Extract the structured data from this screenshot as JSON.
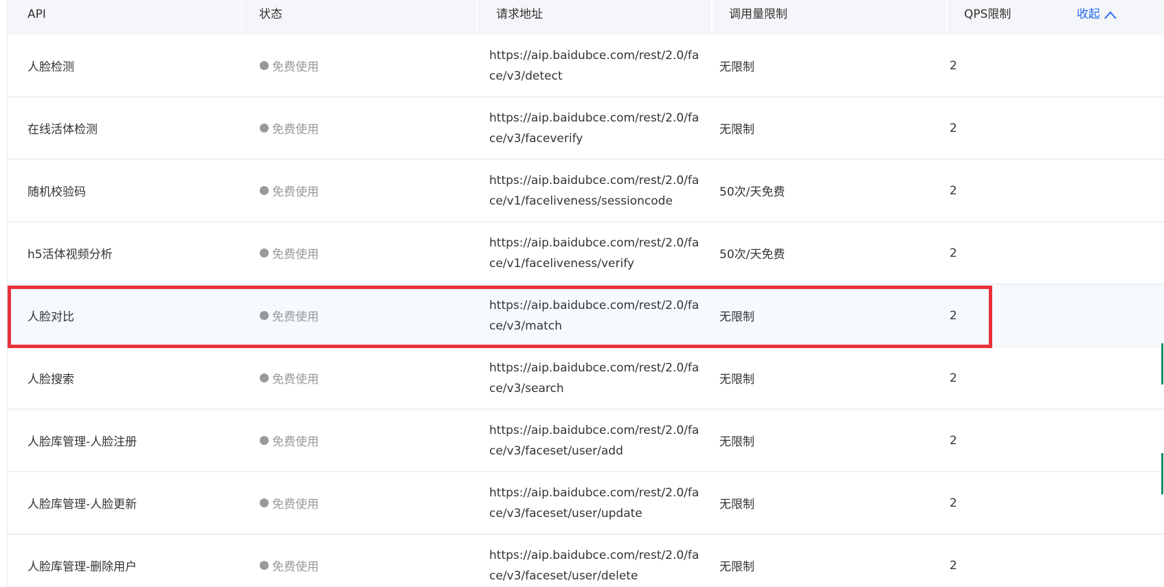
{
  "header": {
    "api": "API",
    "status": "状态",
    "url": "请求地址",
    "quota": "调用量限制",
    "qps": "QPS限制",
    "collapse": "收起"
  },
  "rows": [
    {
      "name": "人脸检测",
      "status": "免费使用",
      "url1": "https://aip.baidubce.com/rest/2.0/fa",
      "url2": "ce/v3/detect",
      "quota": "无限制",
      "qps": "2"
    },
    {
      "name": "在线活体检测",
      "status": "免费使用",
      "url1": "https://aip.baidubce.com/rest/2.0/fa",
      "url2": "ce/v3/faceverify",
      "quota": "无限制",
      "qps": "2"
    },
    {
      "name": "随机校验码",
      "status": "免费使用",
      "url1": "https://aip.baidubce.com/rest/2.0/fa",
      "url2": "ce/v1/faceliveness/sessioncode",
      "quota": "50次/天免费",
      "qps": "2"
    },
    {
      "name": "h5活体视频分析",
      "status": "免费使用",
      "url1": "https://aip.baidubce.com/rest/2.0/fa",
      "url2": "ce/v1/faceliveness/verify",
      "quota": "50次/天免费",
      "qps": "2"
    },
    {
      "name": "人脸对比",
      "status": "免费使用",
      "url1": "https://aip.baidubce.com/rest/2.0/fa",
      "url2": "ce/v3/match",
      "quota": "无限制",
      "qps": "2"
    },
    {
      "name": "人脸搜索",
      "status": "免费使用",
      "url1": "https://aip.baidubce.com/rest/2.0/fa",
      "url2": "ce/v3/search",
      "quota": "无限制",
      "qps": "2"
    },
    {
      "name": "人脸库管理-人脸注册",
      "status": "免费使用",
      "url1": "https://aip.baidubce.com/rest/2.0/fa",
      "url2": "ce/v3/faceset/user/add",
      "quota": "无限制",
      "qps": "2"
    },
    {
      "name": "人脸库管理-人脸更新",
      "status": "免费使用",
      "url1": "https://aip.baidubce.com/rest/2.0/fa",
      "url2": "ce/v3/faceset/user/update",
      "quota": "无限制",
      "qps": "2"
    },
    {
      "name": "人脸库管理-删除用户",
      "status": "免费使用",
      "url1": "https://aip.baidubce.com/rest/2.0/fa",
      "url2": "ce/v3/faceset/user/delete",
      "quota": "无限制",
      "qps": "2"
    }
  ],
  "colors": {
    "accent": "#2468f2",
    "highlight_border": "#e8323a",
    "status_dot": "#999999"
  },
  "highlighted_row": "人脸对比"
}
